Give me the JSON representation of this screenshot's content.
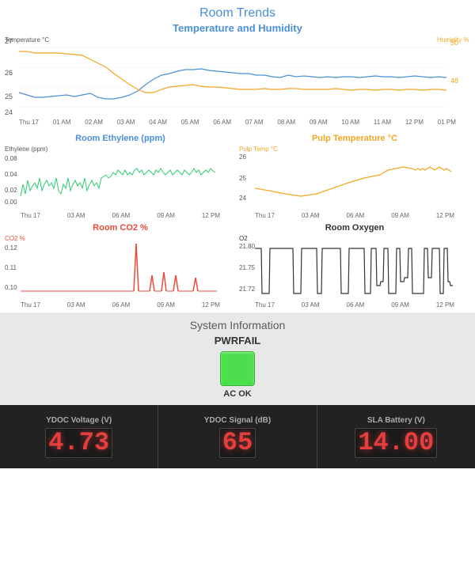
{
  "title": "Room Trends",
  "charts": {
    "tempHumidity": {
      "title": "Temperature and Humidity",
      "yLabel1": "Temperature °C",
      "yLabel2": "Humidity %",
      "yMax1": "27",
      "yMin1": "24",
      "yVal1": "50",
      "yVal2": "48",
      "xLabels": [
        "Thu 17",
        "01 AM",
        "02 AM",
        "03 AM",
        "04 AM",
        "05 AM",
        "06 AM",
        "07 AM",
        "08 AM",
        "09 AM",
        "10 AM",
        "11 AM",
        "12 PM",
        "01 PM"
      ]
    },
    "ethylene": {
      "title": "Room Ethylene (ppm)",
      "yLabel": "Ethylene (ppm)",
      "yValues": [
        "0.08",
        "0.04",
        "0.02",
        "0.00"
      ],
      "xLabels": [
        "Thu 17",
        "03 AM",
        "06 AM",
        "09 AM",
        "12 PM"
      ]
    },
    "pulpTemp": {
      "title": "Pulp Temperature °C",
      "yLabel": "Pulp Temp °C",
      "yValues": [
        "26",
        "25",
        "24"
      ],
      "xLabels": [
        "Thu 17",
        "03 AM",
        "06 AM",
        "09 AM",
        "12 PM"
      ]
    },
    "co2": {
      "title": "Room CO2 %",
      "yLabel": "CO2 %",
      "yValues": [
        "0.12",
        "0.11",
        "0.10"
      ],
      "xLabels": [
        "Thu 17",
        "03 AM",
        "06 AM",
        "09 AM",
        "12 PM"
      ]
    },
    "oxygen": {
      "title": "Room Oxygen",
      "yLabel": "O2",
      "yValues": [
        "21.80",
        "21.75",
        "21.72"
      ],
      "xLabels": [
        "Thu 17",
        "03 AM",
        "06 AM",
        "09 AM",
        "12 PM"
      ]
    }
  },
  "systemInfo": {
    "title": "System Information",
    "pwrfailLabel": "PWRFAIL",
    "acOkText": "AC OK"
  },
  "meters": [
    {
      "label": "YDOC Voltage (V)",
      "value": "4.73"
    },
    {
      "label": "YDOC Signal (dB)",
      "value": "65"
    },
    {
      "label": "SLA Battery (V)",
      "value": "14.00"
    }
  ]
}
